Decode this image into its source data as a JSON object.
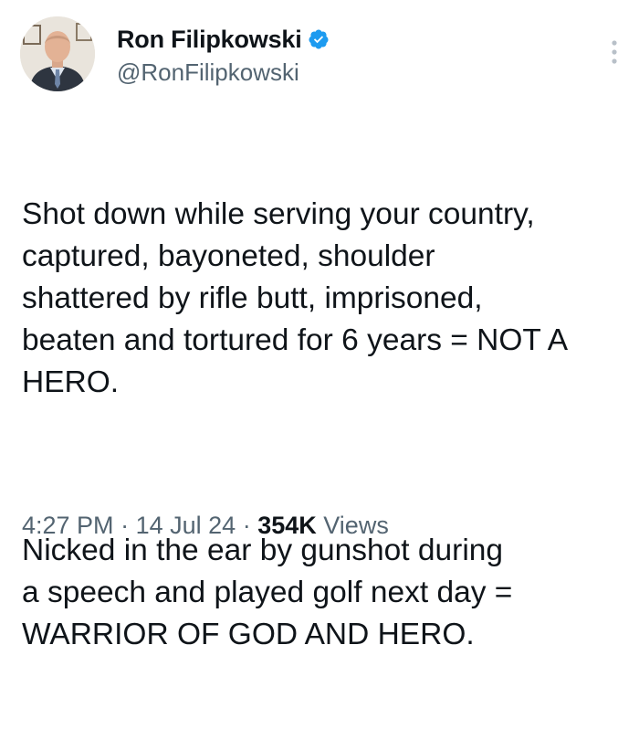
{
  "author": {
    "display_name": "Ron Filipkowski",
    "handle": "@RonFilipkowski",
    "verified": true
  },
  "tweet": {
    "paragraphs": [
      "Shot down while serving your country,\ncaptured, bayoneted, shoulder\nshattered by rifle butt, imprisoned,\nbeaten and tortured for 6 years = NOT A\nHERO.",
      "Nicked in the ear by gunshot during\na speech and played golf next day =\nWARRIOR OF GOD AND HERO."
    ]
  },
  "meta": {
    "time": "4:27 PM",
    "separator": "·",
    "date": "14 Jul 24",
    "views_count": "354K",
    "views_label": "Views"
  },
  "colors": {
    "verified_badge": "#1d9bf0",
    "secondary_text": "#536471",
    "primary_text": "#0f1419"
  },
  "icons": {
    "verified": "verified-badge-icon",
    "more": "more-options-icon"
  }
}
